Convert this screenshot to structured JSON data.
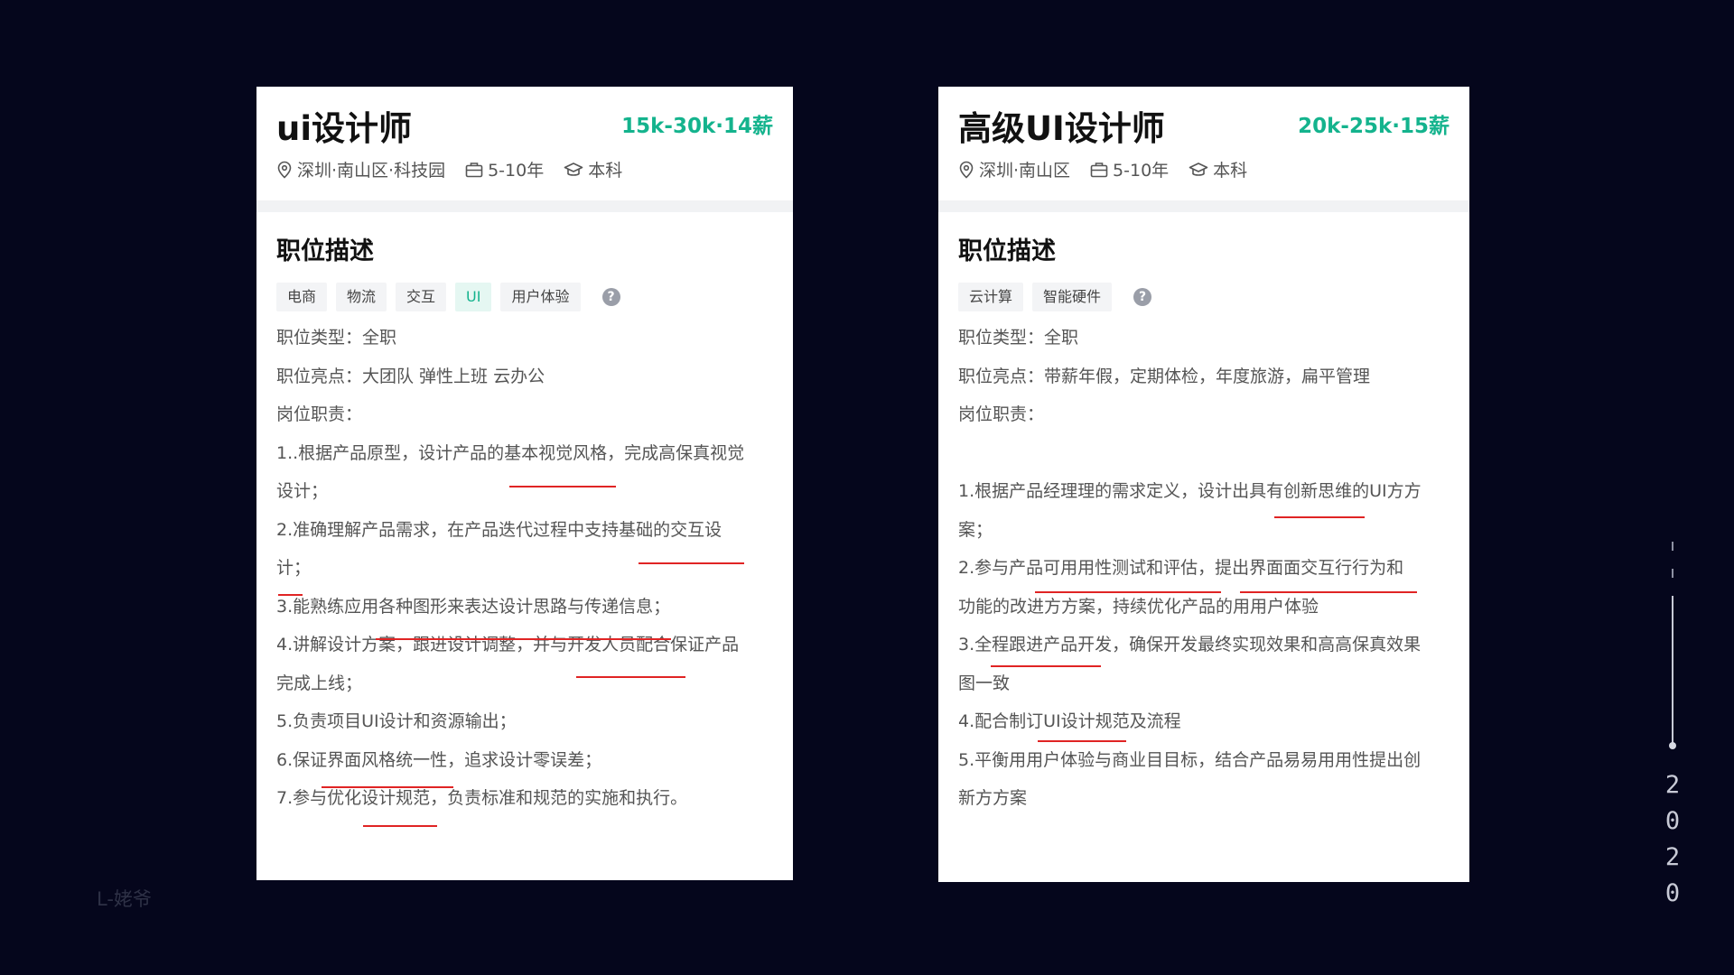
{
  "cards": [
    {
      "title": "ui设计师",
      "salary": "15k-30k·14薪",
      "location": "深圳·南山区·科技园",
      "experience": "5-10年",
      "education": "本科",
      "section_title": "职位描述",
      "tags": [
        {
          "label": "电商",
          "highlighted": false
        },
        {
          "label": "物流",
          "highlighted": false
        },
        {
          "label": "交互",
          "highlighted": false
        },
        {
          "label": "UI",
          "highlighted": true
        },
        {
          "label": "用户体验",
          "highlighted": false
        }
      ],
      "job_type": "职位类型：全职",
      "highlights": "职位亮点：大团队 弹性上班 云办公",
      "duties_label": "岗位职责：",
      "duties": [
        "1..根据产品原型，设计产品的基本视觉风格，完成高保真视觉",
        "设计；",
        "2.准确理解产品需求，在产品迭代过程中支持基础的交互设",
        "计；",
        "3.能熟练应用各种图形来表达设计思路与传递信息；",
        "4.讲解设计方案，跟进设计调整，并与开发人员配合保证产品",
        "完成上线；",
        "5.负责项目UI设计和资源输出；",
        "6.保证界面风格统一性，追求设计零误差；",
        "7.参与优化设计规范，负责标准和规范的实施和执行。"
      ]
    },
    {
      "title": "高级UI设计师",
      "salary": "20k-25k·15薪",
      "location": "深圳·南山区",
      "experience": "5-10年",
      "education": "本科",
      "section_title": "职位描述",
      "tags": [
        {
          "label": "云计算",
          "highlighted": false
        },
        {
          "label": "智能硬件",
          "highlighted": false
        }
      ],
      "job_type": "职位类型：全职",
      "highlights": "职位亮点：带薪年假，定期体检，年度旅游，扁平管理",
      "duties_label": "岗位职责：",
      "duties": [
        "",
        "1.根据产品经理理的需求定义，设计出具有创新思维的UI方方",
        "案；",
        "2.参与产品可用用性测试和评估，提出界面面交互行行为和",
        "功能的改进方方案，持续优化产品的用用户体验",
        "3.全程跟进产品开发，确保开发最终实现效果和高高保真效果",
        "图一致",
        "4.配合制订UI设计规范及流程",
        "5.平衡用用户体验与商业目目标，结合产品易易用用性提出创",
        "新方方案"
      ]
    }
  ],
  "signature": "L-姥爷",
  "year_digits": [
    "2",
    "0",
    "2",
    "0"
  ],
  "colors": {
    "background": "#05061c",
    "salary": "#14b38d",
    "underline": "#e02424"
  },
  "icons": {
    "location": "location-pin-icon",
    "experience": "briefcase-icon",
    "education": "graduation-cap-icon",
    "help": "help-icon"
  }
}
